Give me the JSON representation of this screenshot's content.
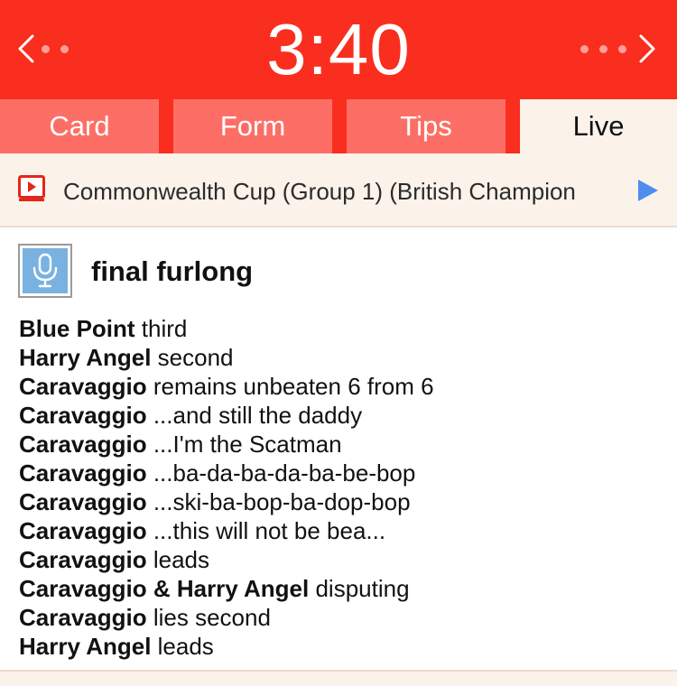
{
  "header": {
    "time": "3:40",
    "brand_color": "#f92e1e"
  },
  "tabs": [
    {
      "label": "Card",
      "active": false
    },
    {
      "label": "Form",
      "active": false
    },
    {
      "label": "Tips",
      "active": false
    },
    {
      "label": "Live",
      "active": true
    }
  ],
  "race": {
    "title": "Commonwealth Cup (Group 1) (British Champion",
    "video_icon": "video-icon",
    "play_icon": "play-icon"
  },
  "feed": {
    "title": "final furlong",
    "avatar_icon": "microphone-icon",
    "lines": [
      {
        "horse": "Blue Point",
        "text": " third"
      },
      {
        "horse": "Harry Angel",
        "text": " second"
      },
      {
        "horse": "Caravaggio",
        "text": " remains unbeaten 6 from 6"
      },
      {
        "horse": "Caravaggio",
        "text": " ...and still the daddy"
      },
      {
        "horse": "Caravaggio",
        "text": " ...I'm the Scatman"
      },
      {
        "horse": "Caravaggio",
        "text": " ...ba-da-ba-da-ba-be-bop"
      },
      {
        "horse": "Caravaggio",
        "text": " ...ski-ba-bop-ba-dop-bop"
      },
      {
        "horse": "Caravaggio",
        "text": " ...this will not be bea..."
      },
      {
        "horse": "Caravaggio",
        "text": " leads"
      },
      {
        "horse": "Caravaggio & Harry Angel",
        "text": " disputing"
      },
      {
        "horse": "Caravaggio",
        "text": " lies second"
      },
      {
        "horse": "Harry Angel",
        "text": " leads"
      }
    ]
  }
}
